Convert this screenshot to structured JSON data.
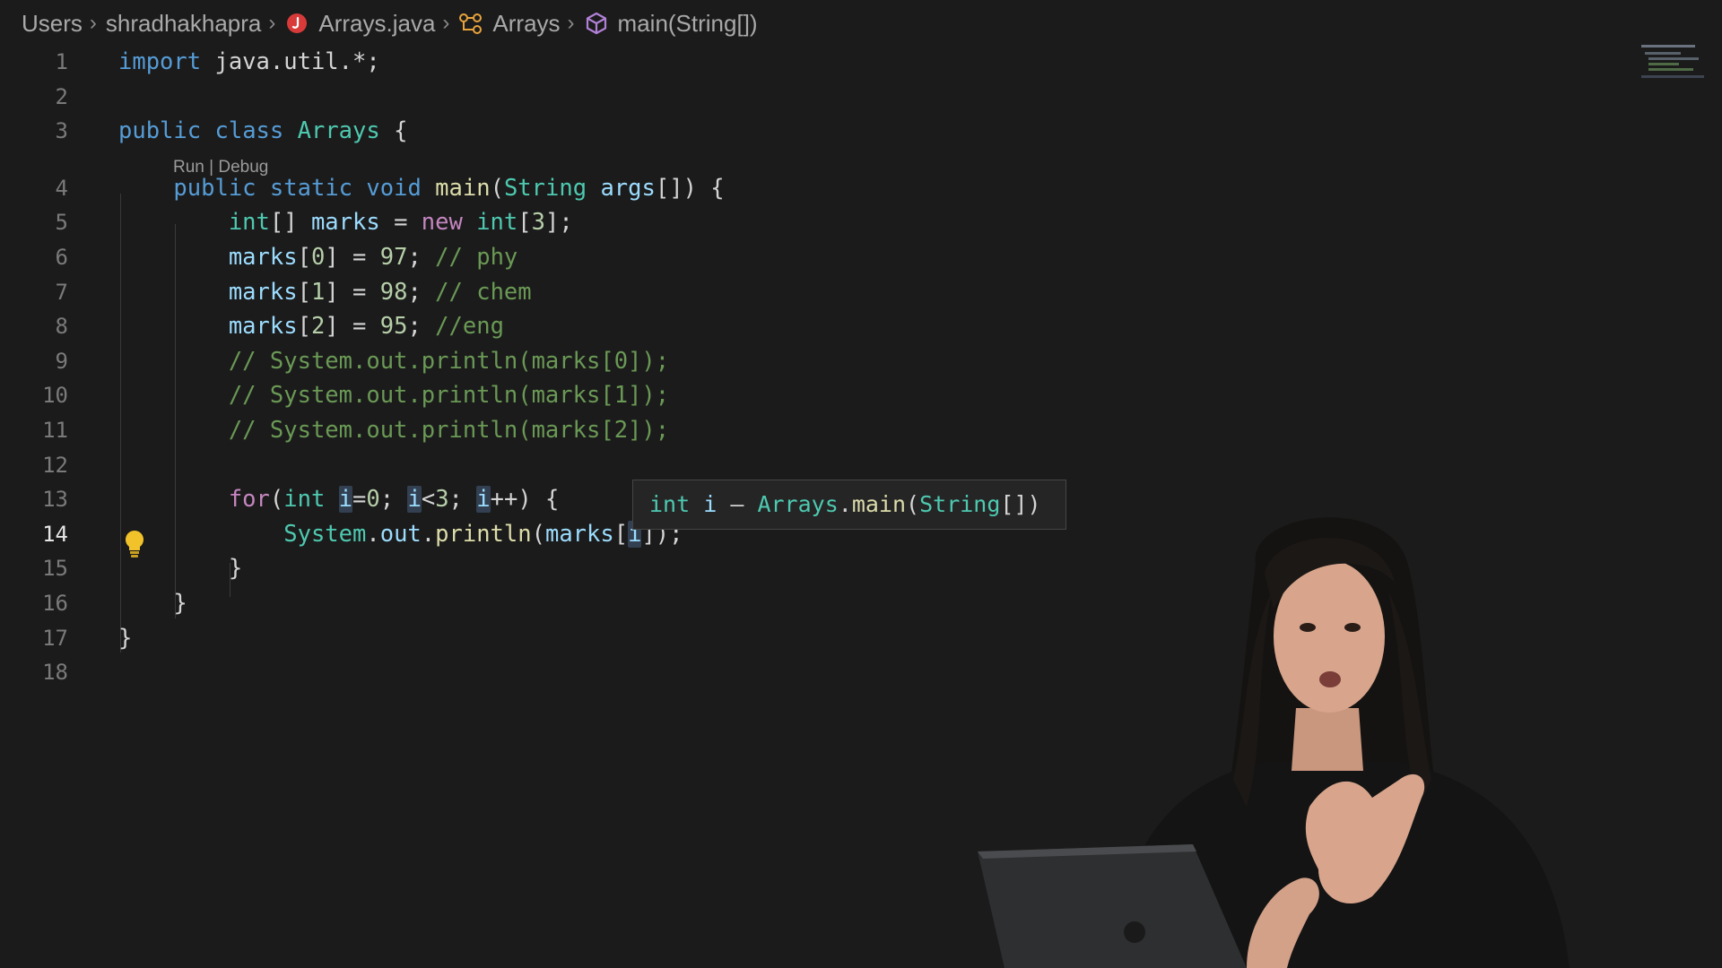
{
  "breadcrumb": {
    "items": [
      {
        "label": "Users"
      },
      {
        "label": "shradhakhapra"
      },
      {
        "label": "Arrays.java"
      },
      {
        "label": "Arrays"
      },
      {
        "label": "main(String[])"
      }
    ]
  },
  "editor": {
    "line_numbers": [
      "1",
      "2",
      "3",
      "4",
      "5",
      "6",
      "7",
      "8",
      "9",
      "10",
      "11",
      "12",
      "13",
      "14",
      "15",
      "16",
      "17",
      "18"
    ],
    "active_line": "14",
    "codelens": "Run | Debug",
    "lines": [
      [
        {
          "t": "import",
          "c": "kw"
        },
        {
          "t": " java.util.*;",
          "c": "punc"
        }
      ],
      [],
      [
        {
          "t": "public",
          "c": "kw"
        },
        {
          "t": " ",
          "c": "punc"
        },
        {
          "t": "class",
          "c": "kw"
        },
        {
          "t": " ",
          "c": "punc"
        },
        {
          "t": "Arrays",
          "c": "type"
        },
        {
          "t": " {",
          "c": "punc"
        }
      ],
      [
        {
          "t": "    ",
          "c": "punc"
        },
        {
          "t": "public",
          "c": "kw"
        },
        {
          "t": " ",
          "c": "punc"
        },
        {
          "t": "static",
          "c": "kw"
        },
        {
          "t": " ",
          "c": "punc"
        },
        {
          "t": "void",
          "c": "kw"
        },
        {
          "t": " ",
          "c": "punc"
        },
        {
          "t": "main",
          "c": "fn"
        },
        {
          "t": "(",
          "c": "punc"
        },
        {
          "t": "String",
          "c": "type"
        },
        {
          "t": " ",
          "c": "punc"
        },
        {
          "t": "args",
          "c": "var"
        },
        {
          "t": "[]) {",
          "c": "punc"
        }
      ],
      [
        {
          "t": "        ",
          "c": "punc"
        },
        {
          "t": "int",
          "c": "type"
        },
        {
          "t": "[] ",
          "c": "punc"
        },
        {
          "t": "marks",
          "c": "var"
        },
        {
          "t": " = ",
          "c": "punc"
        },
        {
          "t": "new",
          "c": "ctrl"
        },
        {
          "t": " ",
          "c": "punc"
        },
        {
          "t": "int",
          "c": "type"
        },
        {
          "t": "[",
          "c": "punc"
        },
        {
          "t": "3",
          "c": "num"
        },
        {
          "t": "];",
          "c": "punc"
        }
      ],
      [
        {
          "t": "        ",
          "c": "punc"
        },
        {
          "t": "marks",
          "c": "var"
        },
        {
          "t": "[",
          "c": "punc"
        },
        {
          "t": "0",
          "c": "num"
        },
        {
          "t": "] = ",
          "c": "punc"
        },
        {
          "t": "97",
          "c": "num"
        },
        {
          "t": "; ",
          "c": "punc"
        },
        {
          "t": "// phy",
          "c": "cmt"
        }
      ],
      [
        {
          "t": "        ",
          "c": "punc"
        },
        {
          "t": "marks",
          "c": "var"
        },
        {
          "t": "[",
          "c": "punc"
        },
        {
          "t": "1",
          "c": "num"
        },
        {
          "t": "] = ",
          "c": "punc"
        },
        {
          "t": "98",
          "c": "num"
        },
        {
          "t": "; ",
          "c": "punc"
        },
        {
          "t": "// chem",
          "c": "cmt"
        }
      ],
      [
        {
          "t": "        ",
          "c": "punc"
        },
        {
          "t": "marks",
          "c": "var"
        },
        {
          "t": "[",
          "c": "punc"
        },
        {
          "t": "2",
          "c": "num"
        },
        {
          "t": "] = ",
          "c": "punc"
        },
        {
          "t": "95",
          "c": "num"
        },
        {
          "t": "; ",
          "c": "punc"
        },
        {
          "t": "//eng",
          "c": "cmt"
        }
      ],
      [
        {
          "t": "        ",
          "c": "punc"
        },
        {
          "t": "// System.out.println(marks[0]);",
          "c": "cmt"
        }
      ],
      [
        {
          "t": "        ",
          "c": "punc"
        },
        {
          "t": "// System.out.println(marks[1]);",
          "c": "cmt"
        }
      ],
      [
        {
          "t": "        ",
          "c": "punc"
        },
        {
          "t": "// System.out.println(marks[2]);",
          "c": "cmt"
        }
      ],
      [],
      [
        {
          "t": "        ",
          "c": "punc"
        },
        {
          "t": "for",
          "c": "ctrl"
        },
        {
          "t": "(",
          "c": "punc"
        },
        {
          "t": "int",
          "c": "type"
        },
        {
          "t": " ",
          "c": "punc"
        },
        {
          "t": "i",
          "c": "var hl"
        },
        {
          "t": "=",
          "c": "punc"
        },
        {
          "t": "0",
          "c": "num"
        },
        {
          "t": "; ",
          "c": "punc"
        },
        {
          "t": "i",
          "c": "var hl"
        },
        {
          "t": "<",
          "c": "punc"
        },
        {
          "t": "3",
          "c": "num"
        },
        {
          "t": "; ",
          "c": "punc"
        },
        {
          "t": "i",
          "c": "var hl"
        },
        {
          "t": "++) {",
          "c": "punc"
        }
      ],
      [
        {
          "t": "            ",
          "c": "punc"
        },
        {
          "t": "System",
          "c": "type"
        },
        {
          "t": ".",
          "c": "punc"
        },
        {
          "t": "out",
          "c": "var"
        },
        {
          "t": ".",
          "c": "punc"
        },
        {
          "t": "println",
          "c": "fn"
        },
        {
          "t": "(",
          "c": "punc"
        },
        {
          "t": "marks",
          "c": "var"
        },
        {
          "t": "[",
          "c": "punc"
        },
        {
          "t": "i",
          "c": "var hl"
        },
        {
          "t": "]);",
          "c": "punc"
        }
      ],
      [
        {
          "t": "        }",
          "c": "punc"
        }
      ],
      [
        {
          "t": "    }",
          "c": "punc"
        }
      ],
      [
        {
          "t": "}",
          "c": "punc"
        }
      ],
      []
    ]
  },
  "hover": {
    "segments": [
      {
        "t": "int",
        "c": "type"
      },
      {
        "t": " ",
        "c": "punc"
      },
      {
        "t": "i",
        "c": "var"
      },
      {
        "t": " – ",
        "c": "punc"
      },
      {
        "t": "Arrays",
        "c": "type"
      },
      {
        "t": ".",
        "c": "punc"
      },
      {
        "t": "main",
        "c": "fn"
      },
      {
        "t": "(",
        "c": "punc"
      },
      {
        "t": "String",
        "c": "type"
      },
      {
        "t": "[])",
        "c": "punc"
      }
    ]
  },
  "icons": {
    "java_file": "java-file-icon",
    "class": "class-icon",
    "method": "method-icon",
    "lightbulb": "lightbulb-icon"
  },
  "colors": {
    "background": "#1b1b1b",
    "keyword": "#569cd6",
    "type": "#4ec9b0",
    "function": "#dcdcaa",
    "variable": "#9cdcfe",
    "number": "#b5cea8",
    "comment": "#6a9955",
    "control": "#c586c0"
  }
}
